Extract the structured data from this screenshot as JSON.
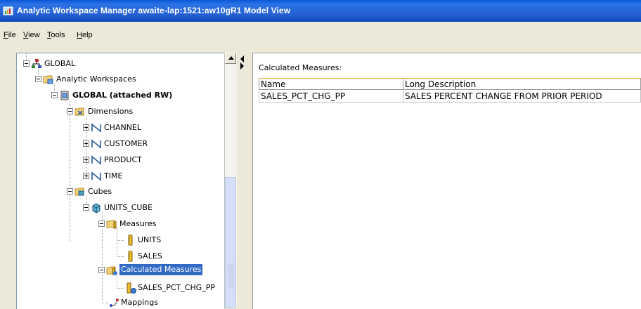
{
  "window": {
    "title": "Analytic Workspace Manager   awaite-lap:1521:aw10gR1   Model View",
    "title_bar_color": "#0a58d8"
  },
  "menu": [
    {
      "accel": "F",
      "rest": "ile"
    },
    {
      "accel": "V",
      "rest": "iew"
    },
    {
      "accel": "T",
      "rest": "ools"
    },
    {
      "accel": "H",
      "rest": "elp"
    }
  ],
  "tree": {
    "global": "GLOBAL",
    "analytic_workspaces": "Analytic Workspaces",
    "workspace": "GLOBAL (attached RW)",
    "dimensions": "Dimensions",
    "channel": "CHANNEL",
    "customer": "CUSTOMER",
    "product": "PRODUCT",
    "time": "TIME",
    "cubes": "Cubes",
    "units_cube": "UNITS_CUBE",
    "measures": "Measures",
    "units": "UNITS",
    "sales": "SALES",
    "calculated_measures": "Calculated Measures",
    "sales_pct_chg_pp": "SALES_PCT_CHG_PP",
    "mappings": "Mappings",
    "selected_color": "#316ac5"
  },
  "detail": {
    "caption": "Calculated Measures:",
    "columns": [
      "Name",
      "Long Description"
    ],
    "rows": [
      [
        "SALES_PCT_CHG_PP",
        "SALES PERCENT CHANGE FROM PRIOR PERIOD"
      ]
    ]
  }
}
